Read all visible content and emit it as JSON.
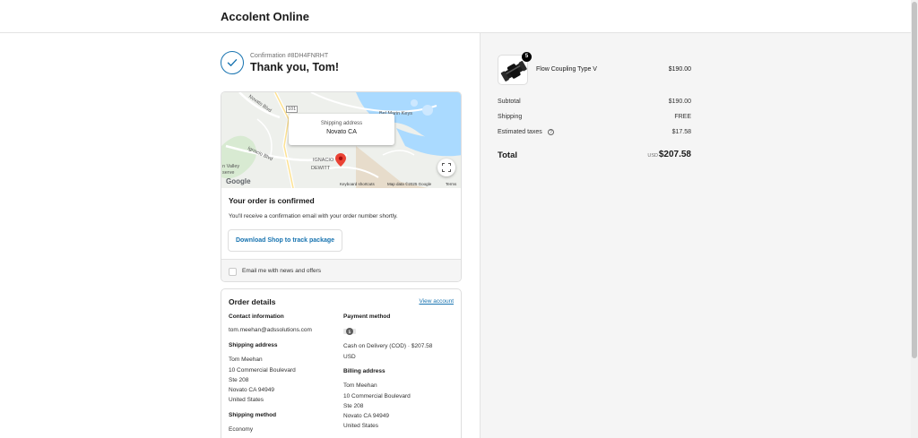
{
  "header": {
    "store_name": "Accolent Online"
  },
  "confirmation": {
    "number": "Confirmation #8DH4FNRHT",
    "thanks": "Thank you, Tom!"
  },
  "map": {
    "bubble_label": "Shipping address",
    "bubble_value": "Novato CA",
    "place_labels": [
      "Novato Blvd",
      "101",
      "Bel Marin Keys",
      "Ignacio Blvd",
      "IGNACIO",
      "DEWITT",
      "n Valley",
      "serve"
    ],
    "google": "Google",
    "attribution": [
      "Keyboard shortcuts",
      "Map data ©2025 Google",
      "Terms"
    ]
  },
  "order_status": {
    "title": "Your order is confirmed",
    "body": "You'll receive a confirmation email with your order number shortly.",
    "shop_button": "Download Shop to track package",
    "email_opt_in": "Email me with news and offers"
  },
  "details": {
    "title": "Order details",
    "view_account": "View account",
    "contact_heading": "Contact information",
    "contact_email": "tom.meehan@adssolutions.com",
    "shipping_heading": "Shipping address",
    "shipping_lines": [
      "Tom Meehan",
      "10 Commercial Boulevard",
      "Ste 208",
      "Novato CA 94949",
      "United States"
    ],
    "method_heading": "Shipping method",
    "method_value": "Economy",
    "payment_heading": "Payment method",
    "payment_icon": "cash-icon",
    "payment_lines": [
      "Cash on Delivery (COD) · $207.58",
      "USD"
    ],
    "billing_heading": "Billing address",
    "billing_lines": [
      "Tom Meehan",
      "10 Commercial Boulevard",
      "Ste 208",
      "Novato CA 94949",
      "United States"
    ]
  },
  "summary": {
    "product": {
      "name": "Flow Coupling Type V",
      "price": "$190.00",
      "quantity": "5"
    },
    "subtotal_label": "Subtotal",
    "subtotal": "$190.00",
    "shipping_label": "Shipping",
    "shipping": "FREE",
    "taxes_label": "Estimated taxes",
    "taxes": "$17.58",
    "total_label": "Total",
    "currency": "USD",
    "total": "$207.58"
  },
  "colors": {
    "accent": "#1773b0",
    "sidebar_bg": "#f5f5f5",
    "map_pin": "#ea4335"
  }
}
